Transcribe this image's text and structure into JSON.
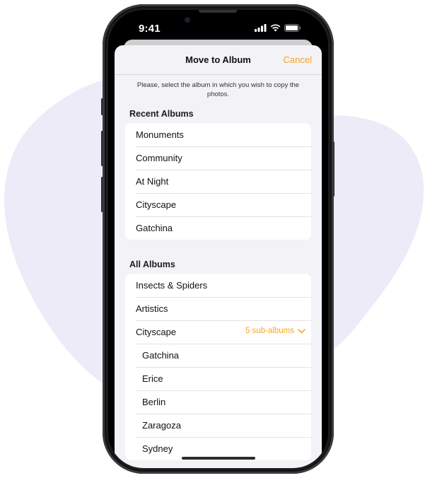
{
  "status_bar": {
    "time": "9:41"
  },
  "sheet": {
    "title": "Move to Album",
    "cancel_label": "Cancel",
    "instruction": "Please, select the album in which you wish to copy the photos."
  },
  "recent_albums": {
    "header": "Recent Albums",
    "items": [
      "Monuments",
      "Community",
      "At Night",
      "Cityscape",
      "Gatchina"
    ]
  },
  "all_albums": {
    "header": "All Albums",
    "items": [
      "Insects & Spiders",
      "Artistics"
    ],
    "expanded": {
      "label": "Cityscape",
      "sub_count_label": "5 sub-albums",
      "sub_albums": [
        "Gatchina",
        "Erice",
        "Berlin",
        "Zaragoza",
        "Sydney"
      ]
    }
  },
  "colors": {
    "accent": "#f5a623",
    "background_blob": "#ecebf7",
    "sheet_background": "#f2f2f7"
  }
}
